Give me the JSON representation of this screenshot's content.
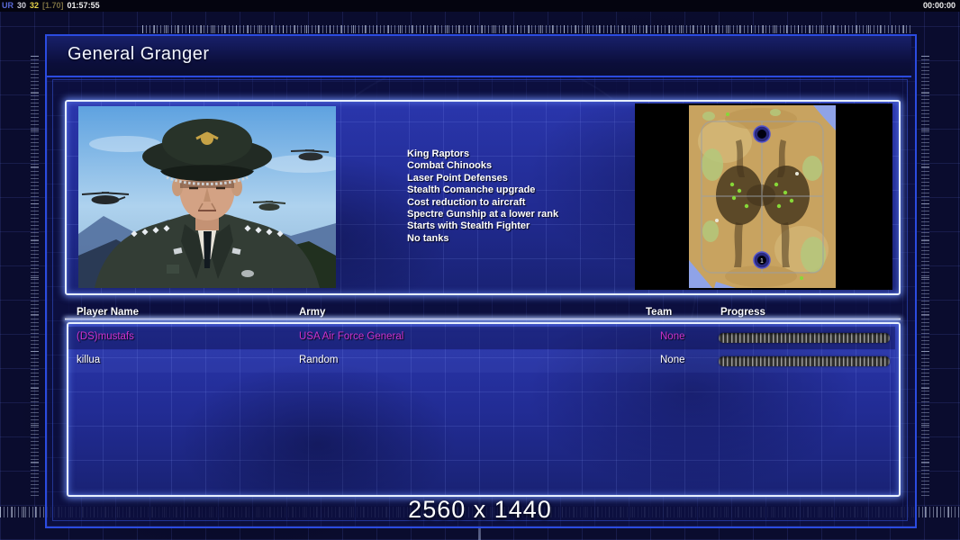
{
  "colors": {
    "frame_blue": "#2b4be0",
    "panel_blue": "#222c96",
    "glow_border": "#e6efff",
    "magenta_player": "#cc33cc",
    "white_player": "#ffffff",
    "stat_yellow": "#e6d34a",
    "map_sand": "#c8a360",
    "progress_light": "#9b9b9b",
    "progress_dark": "#2e2e2e"
  },
  "topbar": {
    "left": {
      "tag": "UR",
      "fps": "30",
      "stat": "32",
      "version": "[1.70]",
      "clock": "01:57:55"
    },
    "right": {
      "timer": "00:00:00"
    }
  },
  "header": {
    "title": "General Granger"
  },
  "general_info": {
    "abilities": [
      "King Raptors",
      "Combat Chinooks",
      "Laser Point Defenses",
      "Stealth Comanche upgrade",
      "Cost reduction to aircraft",
      "Spectre Gunship at a lower rank",
      "Starts with Stealth Fighter",
      "No tanks"
    ]
  },
  "minimap": {
    "start_marker_label": "1"
  },
  "players": {
    "columns": {
      "name": "Player Name",
      "army": "Army",
      "team": "Team",
      "progress": "Progress"
    },
    "rows": [
      {
        "name": "(DS)mustafs",
        "army": "USA Air Force General",
        "team": "None",
        "progress_percent": 100
      },
      {
        "name": "killua",
        "army": "Random",
        "team": "None",
        "progress_percent": 100
      }
    ]
  },
  "footer": {
    "resolution": "2560 x 1440"
  }
}
